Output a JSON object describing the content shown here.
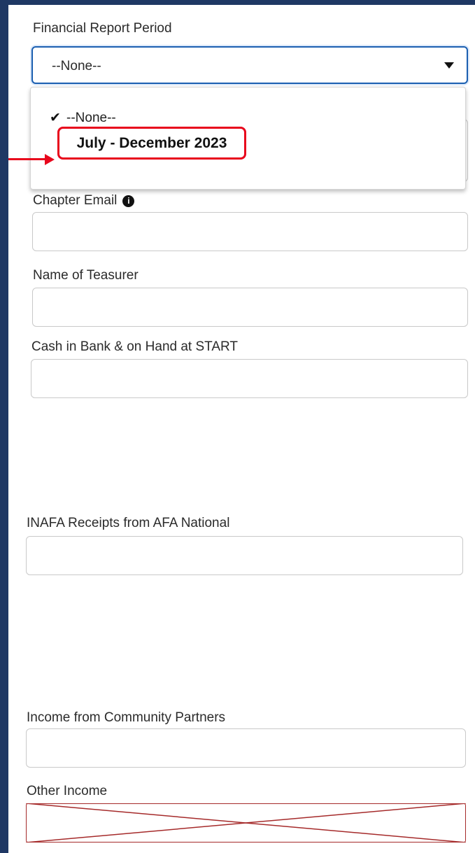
{
  "form": {
    "report_period": {
      "label": "Financial Report Period",
      "value": "--None--",
      "options": [
        {
          "label": "--None--",
          "selected": true
        },
        {
          "label": "July - December 2023",
          "selected": false
        }
      ]
    },
    "chapter_email": {
      "label": "Chapter Email",
      "value": ""
    },
    "treasurer_name": {
      "label": "Name of Teasurer",
      "value": ""
    },
    "cash_start": {
      "label": "Cash in Bank & on Hand at START",
      "value": ""
    },
    "inafa_receipts": {
      "label": "INAFA Receipts from AFA National",
      "value": ""
    },
    "community_income": {
      "label": "Income from Community Partners",
      "value": ""
    },
    "other_income": {
      "label": "Other Income",
      "value": ""
    }
  },
  "icons": {
    "checkmark": "✔",
    "info": "i"
  },
  "colors": {
    "frame_border": "#1f3864",
    "select_focus": "#1b5fb0",
    "highlight_red": "#e8061c",
    "placeholder_cross": "#a52a2a"
  }
}
